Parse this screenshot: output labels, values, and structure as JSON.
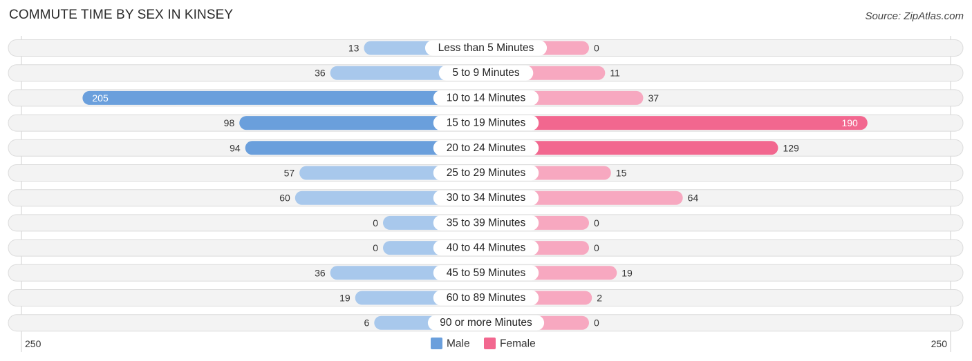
{
  "chart_data": {
    "type": "bar",
    "orientation": "horizontal-diverging",
    "title": "COMMUTE TIME BY SEX IN KINSEY",
    "source": "Source: ZipAtlas.com",
    "categories": [
      "Less than 5 Minutes",
      "5 to 9 Minutes",
      "10 to 14 Minutes",
      "15 to 19 Minutes",
      "20 to 24 Minutes",
      "25 to 29 Minutes",
      "30 to 34 Minutes",
      "35 to 39 Minutes",
      "40 to 44 Minutes",
      "45 to 59 Minutes",
      "60 to 89 Minutes",
      "90 or more Minutes"
    ],
    "series": [
      {
        "name": "Male",
        "color": "#6a9fdc",
        "color_light": "#a8c8ec",
        "values": [
          13,
          36,
          205,
          98,
          94,
          57,
          60,
          0,
          0,
          36,
          19,
          6
        ]
      },
      {
        "name": "Female",
        "color": "#f2678f",
        "color_light": "#f7a8c0",
        "values": [
          0,
          11,
          37,
          190,
          129,
          15,
          64,
          0,
          0,
          19,
          2,
          0
        ]
      }
    ],
    "axis": {
      "left_label": "250",
      "right_label": "250",
      "max": 250
    },
    "legend": {
      "position": "bottom-center",
      "items": [
        "Male",
        "Female"
      ]
    },
    "grid": false
  }
}
